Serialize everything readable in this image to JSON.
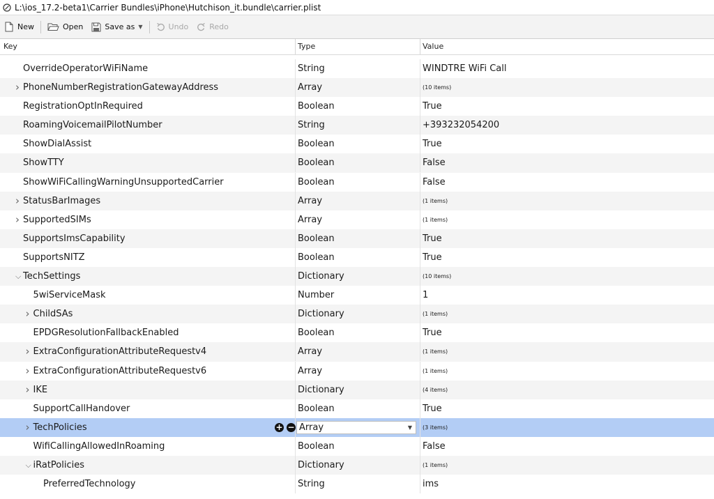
{
  "window": {
    "title": "L:\\ios_17.2-beta1\\Carrier Bundles\\iPhone\\Hutchison_it.bundle\\carrier.plist"
  },
  "toolbar": {
    "new_label": "New",
    "open_label": "Open",
    "saveas_label": "Save as",
    "undo_label": "Undo",
    "redo_label": "Redo"
  },
  "columns": {
    "key": "Key",
    "type": "Type",
    "value": "Value"
  },
  "colors": {
    "selected_row": "#b3cdf5",
    "alt_row": "#f4f4f4"
  },
  "rows": [
    {
      "key": "OverrideOperatorWiFiName",
      "type": "String",
      "value": "WINDTRE WiFi Call",
      "level": 0,
      "expander": "none",
      "small": false
    },
    {
      "key": "PhoneNumberRegistrationGatewayAddress",
      "type": "Array",
      "value": "(10 items)",
      "level": 0,
      "expander": "collapsed",
      "small": true
    },
    {
      "key": "RegistrationOptInRequired",
      "type": "Boolean",
      "value": "True",
      "level": 0,
      "expander": "none",
      "small": false
    },
    {
      "key": "RoamingVoicemailPilotNumber",
      "type": "String",
      "value": "+393232054200",
      "level": 0,
      "expander": "none",
      "small": false
    },
    {
      "key": "ShowDialAssist",
      "type": "Boolean",
      "value": "True",
      "level": 0,
      "expander": "none",
      "small": false
    },
    {
      "key": "ShowTTY",
      "type": "Boolean",
      "value": "False",
      "level": 0,
      "expander": "none",
      "small": false
    },
    {
      "key": "ShowWiFiCallingWarningUnsupportedCarrier",
      "type": "Boolean",
      "value": "False",
      "level": 0,
      "expander": "none",
      "small": false
    },
    {
      "key": "StatusBarImages",
      "type": "Array",
      "value": "(1 items)",
      "level": 0,
      "expander": "collapsed",
      "small": true
    },
    {
      "key": "SupportedSIMs",
      "type": "Array",
      "value": "(1 items)",
      "level": 0,
      "expander": "collapsed",
      "small": true
    },
    {
      "key": "SupportsImsCapability",
      "type": "Boolean",
      "value": "True",
      "level": 0,
      "expander": "none",
      "small": false
    },
    {
      "key": "SupportsNITZ",
      "type": "Boolean",
      "value": "True",
      "level": 0,
      "expander": "none",
      "small": false
    },
    {
      "key": "TechSettings",
      "type": "Dictionary",
      "value": "(10 items)",
      "level": 0,
      "expander": "expanded",
      "small": true
    },
    {
      "key": "5wiServiceMask",
      "type": "Number",
      "value": "1",
      "level": 1,
      "expander": "none",
      "small": false
    },
    {
      "key": "ChildSAs",
      "type": "Dictionary",
      "value": "(1 items)",
      "level": 1,
      "expander": "collapsed",
      "small": true
    },
    {
      "key": "EPDGResolutionFallbackEnabled",
      "type": "Boolean",
      "value": "True",
      "level": 1,
      "expander": "none",
      "small": false
    },
    {
      "key": "ExtraConfigurationAttributeRequestv4",
      "type": "Array",
      "value": "(1 items)",
      "level": 1,
      "expander": "collapsed",
      "small": true
    },
    {
      "key": "ExtraConfigurationAttributeRequestv6",
      "type": "Array",
      "value": "(1 items)",
      "level": 1,
      "expander": "collapsed",
      "small": true
    },
    {
      "key": "IKE",
      "type": "Dictionary",
      "value": "(4 items)",
      "level": 1,
      "expander": "collapsed",
      "small": true
    },
    {
      "key": "SupportCallHandover",
      "type": "Boolean",
      "value": "True",
      "level": 1,
      "expander": "none",
      "small": false
    },
    {
      "key": "TechPolicies",
      "type": "Array",
      "value": "(3 items)",
      "level": 1,
      "expander": "collapsed",
      "small": true,
      "selected": true
    },
    {
      "key": "WifiCallingAllowedInRoaming",
      "type": "Boolean",
      "value": "False",
      "level": 1,
      "expander": "none",
      "small": false
    },
    {
      "key": "iRatPolicies",
      "type": "Dictionary",
      "value": "(1 items)",
      "level": 1,
      "expander": "expanded",
      "small": true
    },
    {
      "key": "PreferredTechnology",
      "type": "String",
      "value": "ims",
      "level": 2,
      "expander": "none",
      "small": false
    }
  ]
}
